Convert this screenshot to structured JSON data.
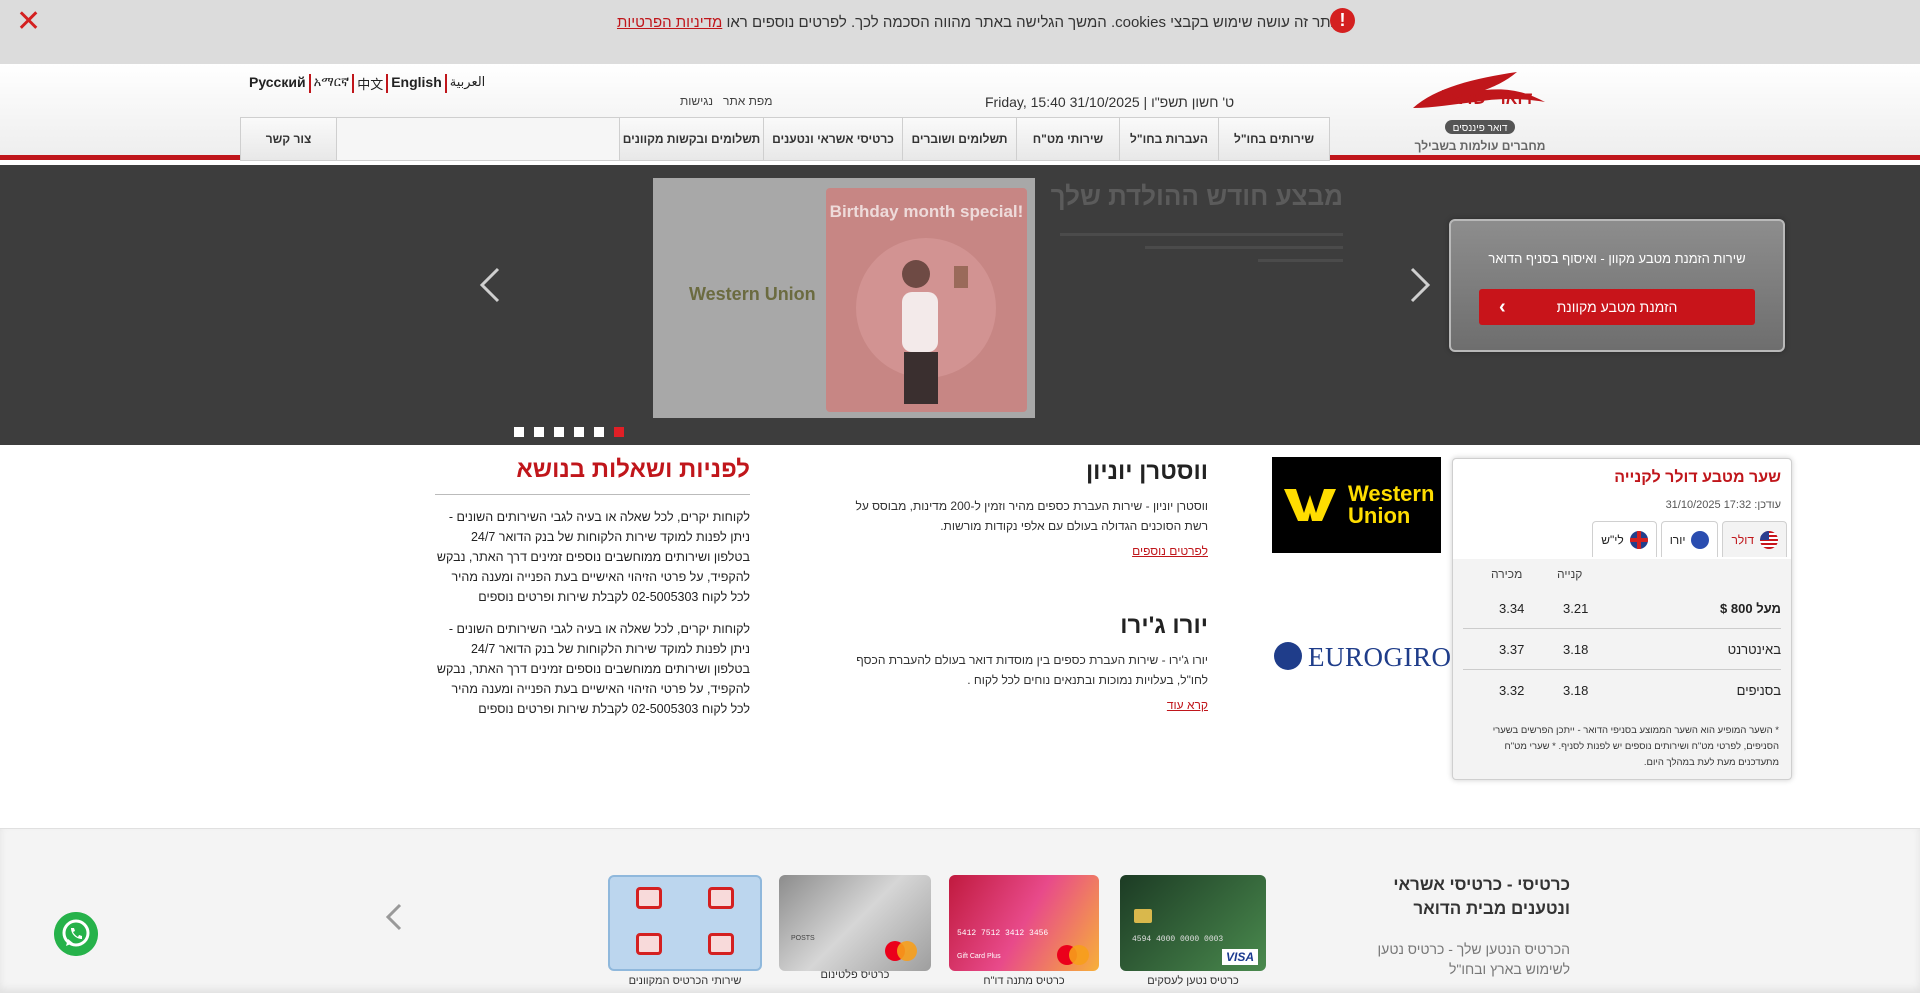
{
  "cookie": {
    "text": "אתר זה עושה שימוש בקבצי cookies. המשך הגלישה באתר מהווה הסכמה לכך. לפרטים נוספים ראו",
    "link": "מדיניות הפרטיות",
    "close_icon": "close-icon",
    "warn_icon": "exclamation-icon"
  },
  "header": {
    "languages": [
      "Русский",
      "አማርኛ",
      "中文",
      "English",
      "العربية"
    ],
    "util_links": [
      "נגישות",
      "מפת אתר"
    ],
    "date": "Friday, ט' חשון תשפ\"ו | 31/10/2025 15:40",
    "logo_text": "דואר ישראל",
    "logo_sub": "דואר פיננסים",
    "logo_tagline": "מחברים עולמות בשבילך",
    "nav": [
      "שירותים בחו\"ל",
      "העברות בחו\"ל",
      "שירותי מט\"ח",
      "תשלומים ושוברים",
      "כרטיסי אשראי ונטענים",
      "תשלומים ובקשות מקוונים",
      "צור קשר"
    ],
    "search_placeholder": ""
  },
  "hero": {
    "title": "מבצע חודש ההולדת שלך",
    "slide_badge": "Birthday month special!",
    "slide_brand": "Western Union",
    "promo_text": "שירות הזמנת מטבע מקוון - ואיסוף בסניף הדואר",
    "promo_button": "הזמנת מטבע מקוונת",
    "dots": 6,
    "active_dot": 6
  },
  "rates": {
    "title": "שער מטבע דולר לקנייה",
    "updated": "עודכן: 17:32   31/10/2025",
    "tabs": [
      {
        "label": "דולר",
        "flag": "us-flag-icon",
        "active": true
      },
      {
        "label": "יורו",
        "flag": "eu-flag-icon",
        "active": false
      },
      {
        "label": "לי\"ש",
        "flag": "uk-flag-icon",
        "active": false
      }
    ],
    "col_buy": "קנייה",
    "col_sell": "מכירה",
    "rows": [
      {
        "label": "מעל 800 $",
        "buy": "3.21",
        "sell": "3.34"
      },
      {
        "label": "באינטרנט",
        "buy": "3.18",
        "sell": "3.37"
      },
      {
        "label": "בסניפים",
        "buy": "3.18",
        "sell": "3.32"
      }
    ],
    "note": "* השער המופיע הוא השער הממוצע בסניפי הדואר - ייתכן הפרשים בשערי הסניפים, לפרטי מט\"ח ושירותים נוספים יש לפנות לסניף. * שערי מט\"ח מתעדכנים מעת לעת במהלך היום."
  },
  "partners": {
    "wu_line1": "Western",
    "wu_line2": "Union",
    "eurogiro": "EUROGIRO"
  },
  "info": [
    {
      "title": "ווסטרן יוניון",
      "text": "ווסטרן יוניון - שירות העברת כספים מהיר וזמין ל-200 מדינות, מבוסס על רשת הסוכנים הגדולה בעולם עם אלפי נקודות מורשות.",
      "link": "לפרטים נוספים"
    },
    {
      "title": "יורו ג'ירו",
      "text": "יורו ג'ירו - שירות העברת כספים בין מוסדות דואר בעולם להעברת הכסף לחו\"ל, בעלויות נמוכות ובתנאים נוחים לכל לקוח .",
      "link": "קרא עוד"
    }
  ],
  "contact": {
    "title": "לפניות ושאלות בנושא",
    "paragraphs": [
      "לקוחות יקרים, לכל שאלה או בעיה לגבי השירותים השונים - ניתן לפנות למוקד שירות הלקוחות של בנק הדואר 24/7 בטלפון ושירותים ממוחשבים נוספים זמינים דרך האתר, נבקש להקפיד, על פרטי הזיהוי האישיים בעת הפנייה ומענה מהיר לכל לקוח 02-5005303 לקבלת שירות ופרטים נוספים",
      "לקוחות יקרים, לכל שאלה או בעיה לגבי השירותים השונים - ניתן לפנות למוקד שירות הלקוחות של בנק הדואר 24/7 בטלפון ושירותים ממוחשבים נוספים זמינים דרך האתר, נבקש להקפיד, על פרטי הזיהוי האישיים בעת הפנייה ומענה מהיר לכל לקוח 02-5005303 לקבלת שירות ופרטים נוספים"
    ]
  },
  "bottom": {
    "title": "כרטיסי - כרטיסי אשראי ונטענים מבית הדואר",
    "subtitle": "הכרטיס הנטען שלך - כרטיס נטען לשימוש בארץ ובחו\"ל",
    "cards": [
      {
        "caption": "כרטיס נטען לעסקים",
        "network": "visa"
      },
      {
        "caption": "כרטיס מתנה דו\"ח",
        "network": "mastercard"
      },
      {
        "caption": "כרטיס פלטינום",
        "network": "mastercard"
      },
      {
        "caption": "שירותי הכרטיס המקוונים",
        "network": ""
      }
    ],
    "card_visa_number": "4594 4000 0000 0003",
    "card_gift_label": "Gift Card Plus",
    "card_gift_number": "5412 7512 3412 3456",
    "card_plat_label": "POSTS",
    "whatsapp_icon": "whatsapp-icon"
  },
  "colors": {
    "brand": "#c0161b",
    "hero_bg": "#3d3d3d",
    "wu_yellow": "#ffdd00",
    "eurogiro_blue": "#1f3d8a"
  }
}
